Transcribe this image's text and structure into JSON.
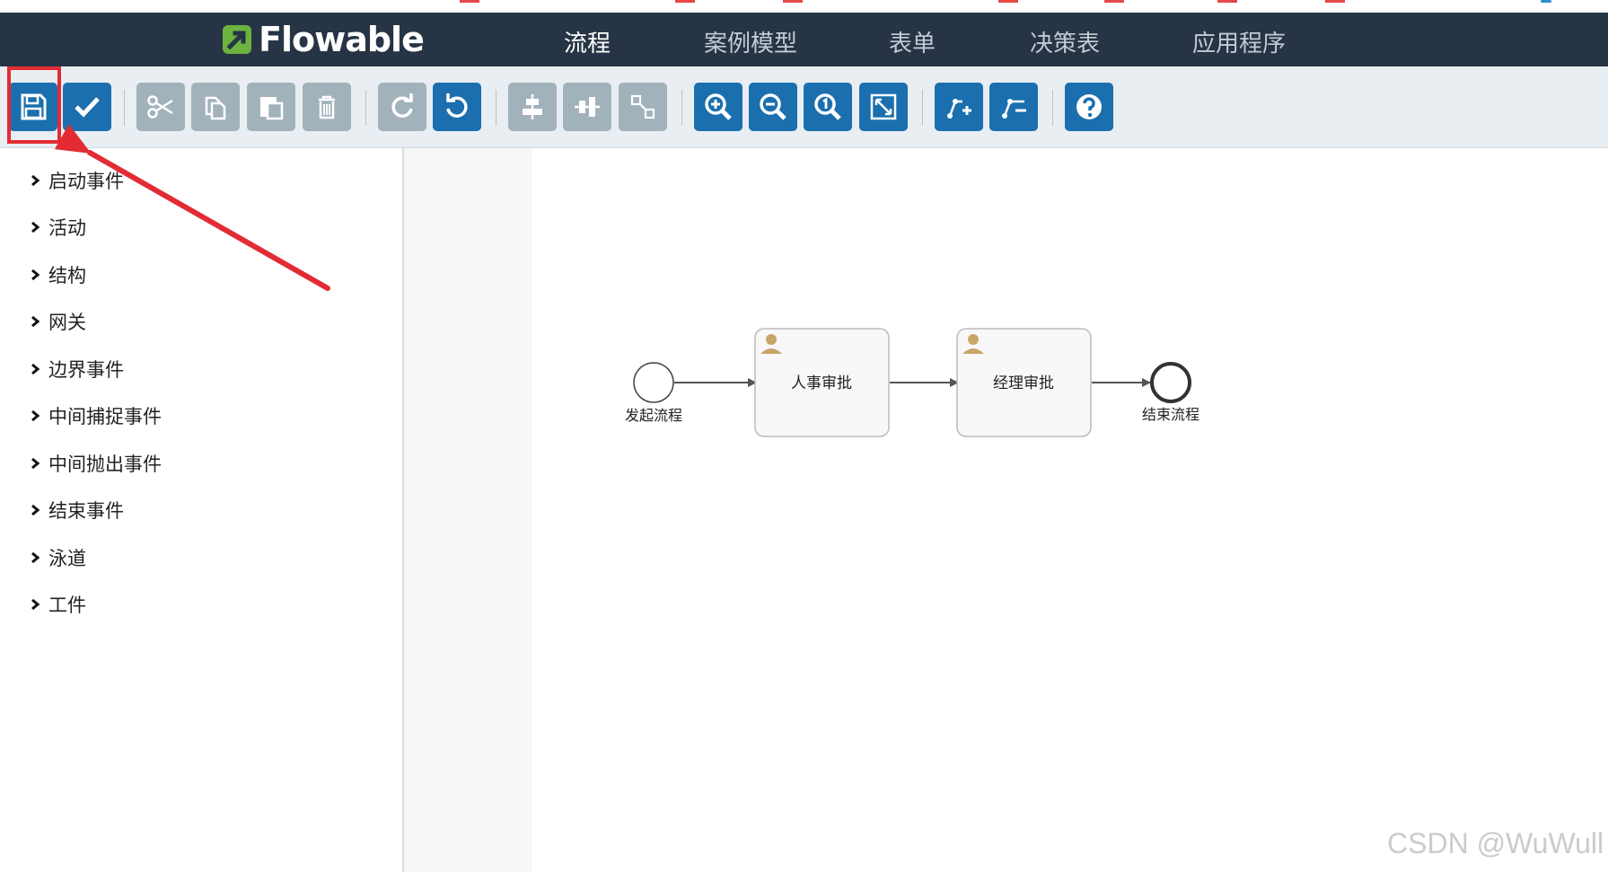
{
  "app": {
    "logo_text": "Flowable",
    "brand_color": "#263445",
    "logo_green": "#6cb33f"
  },
  "nav": {
    "items": [
      {
        "label": "流程",
        "active": true
      },
      {
        "label": "案例模型",
        "active": false
      },
      {
        "label": "表单",
        "active": false
      },
      {
        "label": "决策表",
        "active": false
      },
      {
        "label": "应用程序",
        "active": false
      }
    ]
  },
  "toolbar": {
    "buttons": [
      {
        "name": "save",
        "icon": "floppy-disk-icon",
        "style": "blue"
      },
      {
        "name": "validate",
        "icon": "checkmark-icon",
        "style": "blue"
      },
      {
        "name": "cut",
        "icon": "scissors-icon",
        "style": "grey"
      },
      {
        "name": "copy",
        "icon": "copy-icon",
        "style": "grey"
      },
      {
        "name": "paste",
        "icon": "paste-icon",
        "style": "grey"
      },
      {
        "name": "delete",
        "icon": "trash-icon",
        "style": "grey"
      },
      {
        "name": "redo",
        "icon": "redo-icon",
        "style": "grey"
      },
      {
        "name": "undo",
        "icon": "undo-icon",
        "style": "blue"
      },
      {
        "name": "align-horizontal",
        "icon": "align-horizontal-icon",
        "style": "grey"
      },
      {
        "name": "align-vertical",
        "icon": "align-vertical-icon",
        "style": "grey"
      },
      {
        "name": "same-size",
        "icon": "same-size-icon",
        "style": "grey"
      },
      {
        "name": "zoom-in",
        "icon": "zoom-in-icon",
        "style": "blue"
      },
      {
        "name": "zoom-out",
        "icon": "zoom-out-icon",
        "style": "blue"
      },
      {
        "name": "zoom-actual",
        "icon": "zoom-actual-icon",
        "style": "blue"
      },
      {
        "name": "zoom-fit",
        "icon": "zoom-fit-icon",
        "style": "blue"
      },
      {
        "name": "add-bendpoint",
        "icon": "add-bendpoint-icon",
        "style": "blue"
      },
      {
        "name": "remove-bendpoint",
        "icon": "remove-bendpoint-icon",
        "style": "blue"
      },
      {
        "name": "help",
        "icon": "help-icon",
        "style": "blue"
      }
    ],
    "blue": "#1b6fae",
    "grey": "#a2b2bb"
  },
  "palette": {
    "groups": [
      {
        "label": "启动事件"
      },
      {
        "label": "活动"
      },
      {
        "label": "结构"
      },
      {
        "label": "网关"
      },
      {
        "label": "边界事件"
      },
      {
        "label": "中间捕捉事件"
      },
      {
        "label": "中间抛出事件"
      },
      {
        "label": "结束事件"
      },
      {
        "label": "泳道"
      },
      {
        "label": "工件"
      }
    ]
  },
  "diagram": {
    "start_label": "发起流程",
    "task1_label": "人事审批",
    "task2_label": "经理审批",
    "end_label": "结束流程",
    "task_fill": "#f8f8f8",
    "user_icon_color": "#c9a56a"
  },
  "annotation": {
    "color": "#e32b34"
  },
  "watermark": "CSDN @WuWull"
}
